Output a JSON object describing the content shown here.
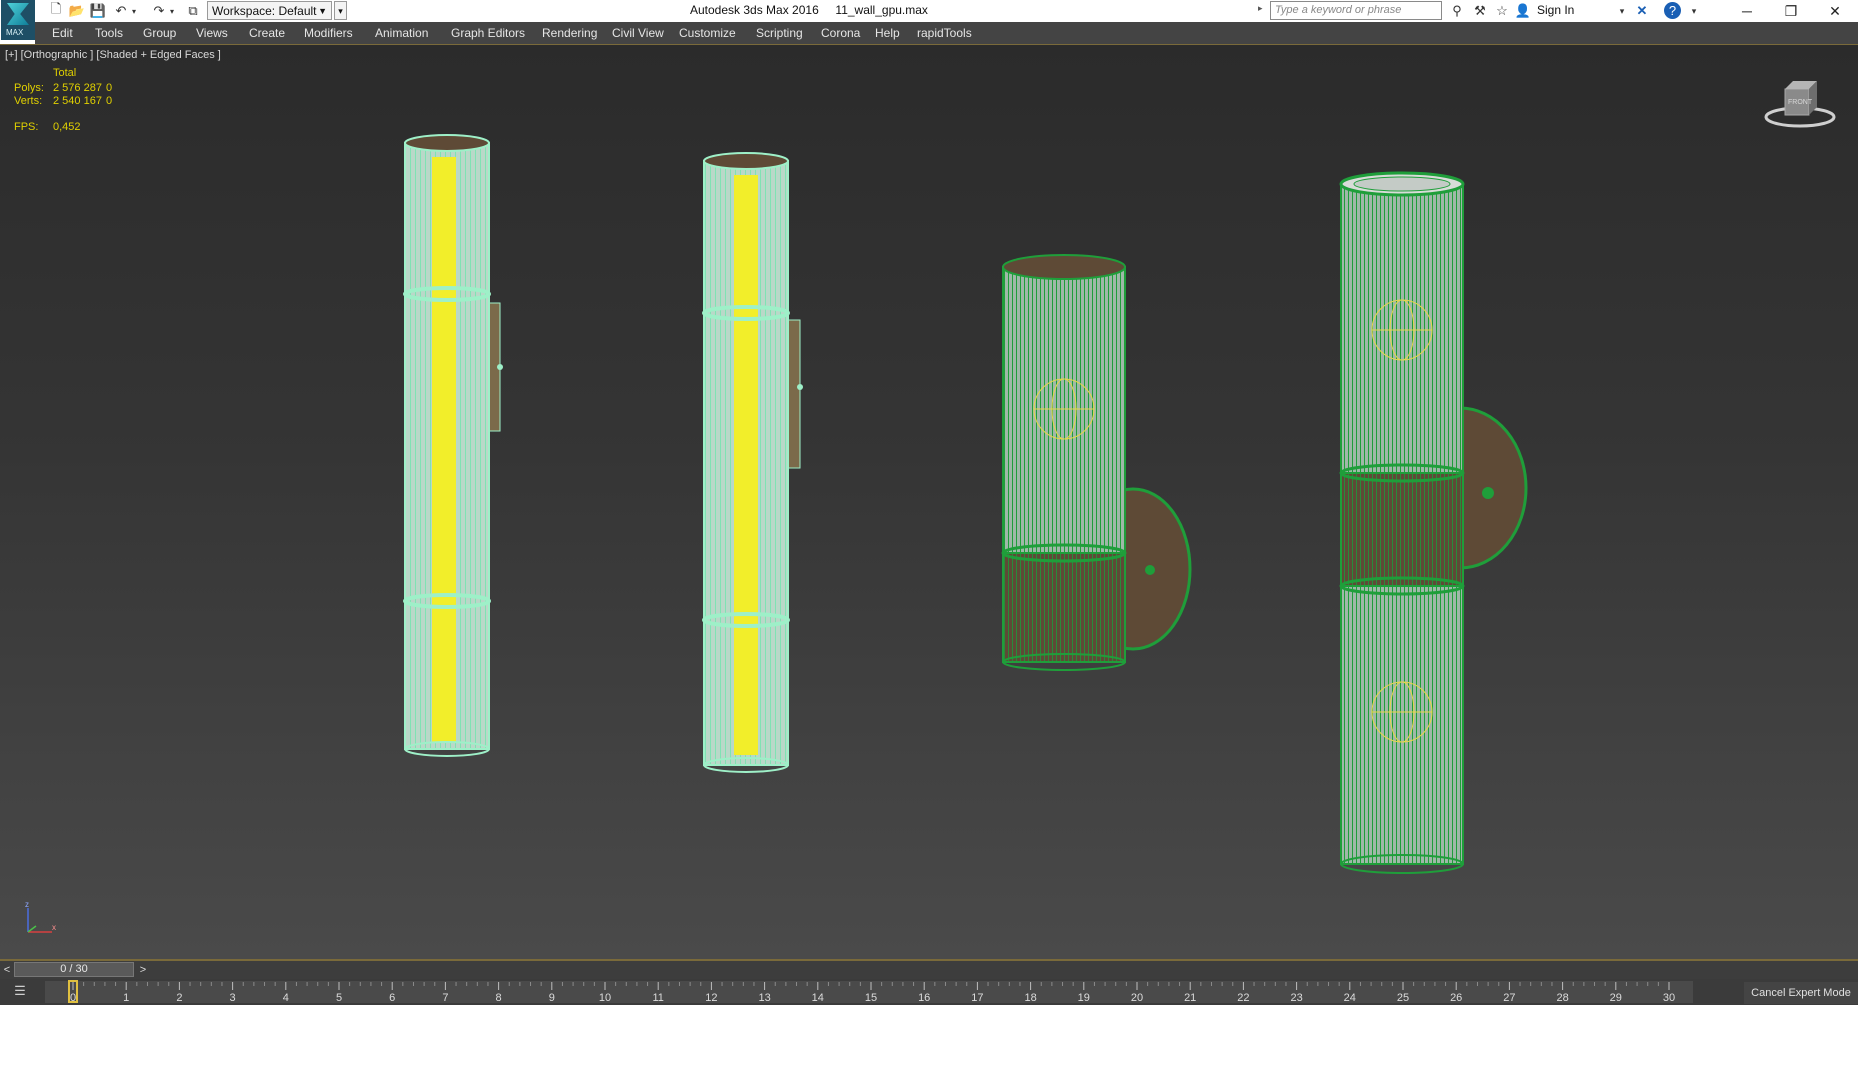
{
  "titlebar": {
    "app_name": "Autodesk 3ds Max 2016",
    "file_name": "11_wall_gpu.max",
    "logo_text": "MAX",
    "workspace_label": "Workspace: Default",
    "search_placeholder": "Type a keyword or phrase",
    "sign_in": "Sign In"
  },
  "menu": {
    "items": [
      "Edit",
      "Tools",
      "Group",
      "Views",
      "Create",
      "Modifiers",
      "Animation",
      "Graph Editors",
      "Rendering",
      "Civil View",
      "Customize",
      "Scripting",
      "Corona",
      "Help",
      "rapidTools"
    ]
  },
  "viewport": {
    "label": "[+] [Orthographic ] [Shaded + Edged Faces ]",
    "stats": {
      "header": "Total",
      "polys_label": "Polys:",
      "polys_value": "2 576 287",
      "polys_sel": "0",
      "verts_label": "Verts:",
      "verts_value": "2 540 167",
      "verts_sel": "0",
      "fps_label": "FPS:",
      "fps_value": "0,452"
    },
    "viewcube_label": "FRONT",
    "axis_labels": {
      "z": "z",
      "x": "x"
    },
    "colors": {
      "selected_wire": "#9ef0c8",
      "glow_strip": "#f2ee2a",
      "object_wire": "#1f9e3a",
      "bronze": "#5e4a36",
      "stats_text": "#e0d000"
    }
  },
  "timeline": {
    "frame_display": "0 / 30",
    "prev_label": "<",
    "next_label": ">",
    "ticks": [
      "0",
      "1",
      "2",
      "3",
      "4",
      "5",
      "6",
      "7",
      "8",
      "9",
      "10",
      "11",
      "12",
      "13",
      "14",
      "15",
      "16",
      "17",
      "18",
      "19",
      "20",
      "21",
      "22",
      "23",
      "24",
      "25",
      "26",
      "27",
      "28",
      "29",
      "30"
    ],
    "current_frame": 0,
    "cancel_expert_mode": "Cancel Expert Mode"
  }
}
